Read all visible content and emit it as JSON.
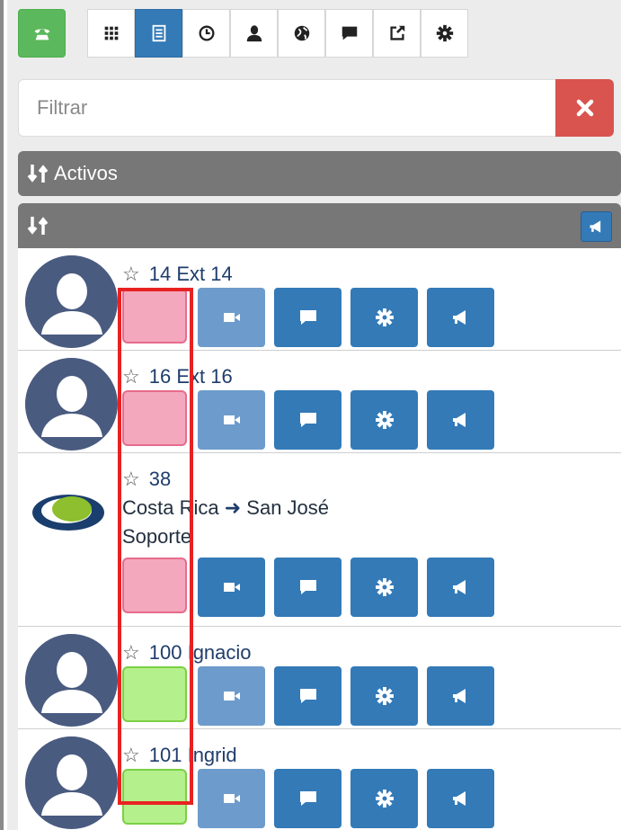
{
  "toolbar": {
    "items": [
      {
        "icon": "phone-icon"
      },
      {
        "icon": "keypad-icon"
      },
      {
        "icon": "contacts-list-icon"
      },
      {
        "icon": "history-clock-icon"
      },
      {
        "icon": "user-icon"
      },
      {
        "icon": "globe-icon"
      },
      {
        "icon": "chat-icon"
      },
      {
        "icon": "share-icon"
      },
      {
        "icon": "settings-icon"
      }
    ],
    "colors": {
      "call": "#5cb85c",
      "active_tab": "#337ab7"
    }
  },
  "filter": {
    "placeholder": "Filtrar",
    "value": "",
    "clear_icon": "close-icon"
  },
  "sections": {
    "active_label": "Activos",
    "list_label": ""
  },
  "contacts": [
    {
      "ext": "14",
      "name": "Ext 14",
      "status": "pink",
      "avatar": "default-avatar"
    },
    {
      "ext": "16",
      "name": "Ext 16",
      "status": "pink",
      "avatar": "default-avatar"
    },
    {
      "ext": "38",
      "name": "",
      "country": "Costa Rica",
      "city": "San José",
      "dept": "Soporte",
      "status": "pink",
      "avatar": "company-logo"
    },
    {
      "ext": "100",
      "name": "Ignacio",
      "status": "green",
      "avatar": "default-avatar"
    },
    {
      "ext": "101",
      "name": "Ingrid",
      "status": "green",
      "avatar": "default-avatar"
    }
  ],
  "status_colors": {
    "pink": "#f4a8bd",
    "green": "#b4f08c",
    "annotation": "#e82222"
  },
  "star_glyph": "☆",
  "arrow_glyph": "➜"
}
